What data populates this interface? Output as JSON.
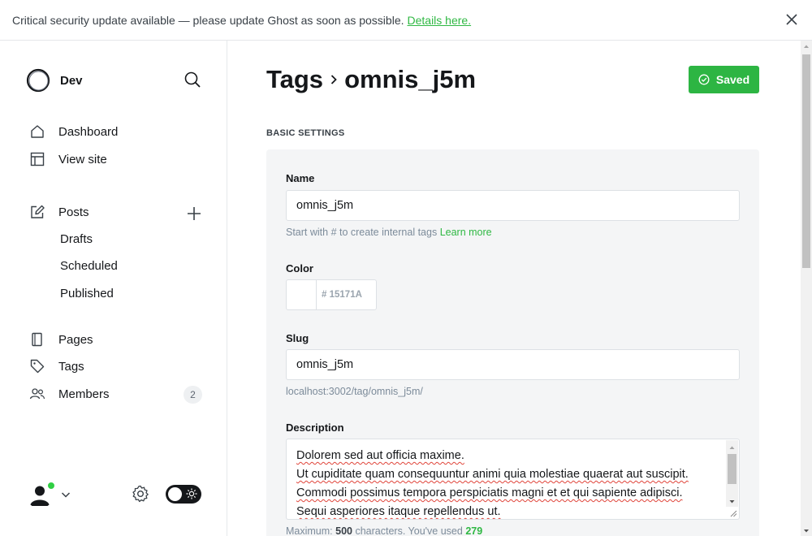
{
  "banner": {
    "message": "Critical security update available — please update Ghost as soon as possible.",
    "link": "Details here."
  },
  "site": {
    "name": "Dev"
  },
  "nav": {
    "dashboard": "Dashboard",
    "view_site": "View site",
    "posts": "Posts",
    "drafts": "Drafts",
    "scheduled": "Scheduled",
    "published": "Published",
    "pages": "Pages",
    "tags": "Tags",
    "members": "Members",
    "members_count": "2"
  },
  "header": {
    "breadcrumb_parent": "Tags",
    "breadcrumb_current": "omnis_j5m",
    "saved_label": "Saved"
  },
  "form": {
    "section_title": "BASIC SETTINGS",
    "name_label": "Name",
    "name_value": "omnis_j5m",
    "name_hint": "Start with # to create internal tags",
    "learn_more": "Learn more",
    "color_label": "Color",
    "color_hash": "#",
    "color_value": "15171A",
    "slug_label": "Slug",
    "slug_value": "omnis_j5m",
    "slug_url": "localhost:3002/tag/omnis_j5m/",
    "description_label": "Description",
    "description_lines": [
      "Dolorem sed aut officia maxime.",
      "Ut cupiditate quam consequuntur animi quia molestiae quaerat aut suscipit.",
      "Commodi possimus tempora perspiciatis magni et et qui sapiente adipisci.",
      "Sequi asperiores itaque repellendus ut."
    ],
    "counter_prefix": "Maximum:",
    "counter_max": "500",
    "counter_mid": "characters. You've used",
    "counter_used": "279"
  },
  "colors": {
    "accent": "#30cf43",
    "saved_button": "#2db543",
    "text": "#15171a"
  },
  "icons": {
    "close": "close-icon",
    "search": "search-icon",
    "dashboard": "house-icon",
    "view_site": "layout-icon",
    "posts": "pencil-icon",
    "add_post": "plus-icon",
    "pages": "pages-icon",
    "tags": "tag-icon",
    "members": "people-icon",
    "settings": "gear-icon",
    "theme": "sun-icon"
  }
}
